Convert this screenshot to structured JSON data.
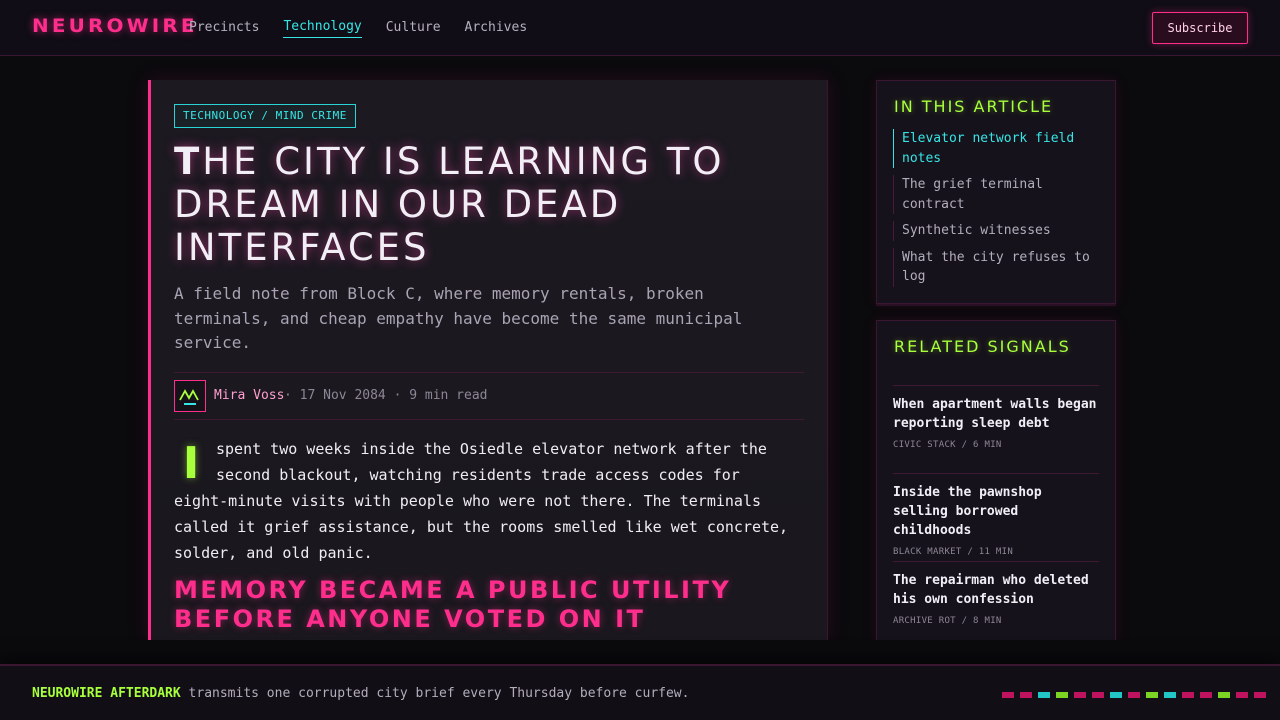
{
  "header": {
    "logo": "NEUROWIRE",
    "nav": [
      "Precincts",
      "Technology",
      "Culture",
      "Archives"
    ],
    "active_nav": "Technology",
    "subscribe_label": "Subscribe"
  },
  "article": {
    "tag": "TECHNOLOGY / MIND CRIME",
    "title": "The City Is Learning to Dream in Our Dead Interfaces",
    "subtitle": "A field note from Block C, where memory rentals, broken terminals, and cheap empathy have become the same municipal service.",
    "author": "Mira Voss",
    "meta": "· 17 Nov 2084 · 9 min read",
    "dropcap": "I",
    "body": "spent two weeks inside the Osiedle elevator network after the second blackout, watching residents trade access codes for eight-minute visits with people who were not there. The terminals called it grief assistance, but the rooms smelled like wet concrete, solder, and old panic.",
    "section_heading": "Memory became a public utility before anyone voted on it"
  },
  "toc": {
    "heading": "In this article",
    "items": [
      {
        "label": "Elevator network field notes",
        "active": true
      },
      {
        "label": "The grief terminal contract",
        "active": false
      },
      {
        "label": "Synthetic witnesses",
        "active": false
      },
      {
        "label": "What the city refuses to log",
        "active": false
      }
    ]
  },
  "related": {
    "heading": "Related signals",
    "items": [
      {
        "title": "When apartment walls began reporting sleep debt",
        "meta": "CIVIC STACK / 6 MIN"
      },
      {
        "title": "Inside the pawnshop selling borrowed childhoods",
        "meta": "BLACK MARKET / 11 MIN"
      },
      {
        "title": "The repairman who deleted his own confession",
        "meta": "ARCHIVE ROT / 8 MIN"
      }
    ]
  },
  "footer": {
    "brand": "NEUROWIRE AFTERDARK",
    "text": " transmits one corrupted city brief every Thursday before curfew."
  },
  "colors": {
    "accent_pink": "#ff2e8c",
    "accent_cyan": "#36e6e6",
    "accent_green": "#a8ff3c",
    "footer_bar": [
      "#c0135f",
      "#c0135f",
      "#22c6c6",
      "#7bd424",
      "#c0135f",
      "#c0135f",
      "#22c6c6",
      "#c0135f",
      "#7bd424",
      "#22c6c6",
      "#c0135f",
      "#c0135f",
      "#7bd424",
      "#c0135f",
      "#c0135f"
    ]
  }
}
